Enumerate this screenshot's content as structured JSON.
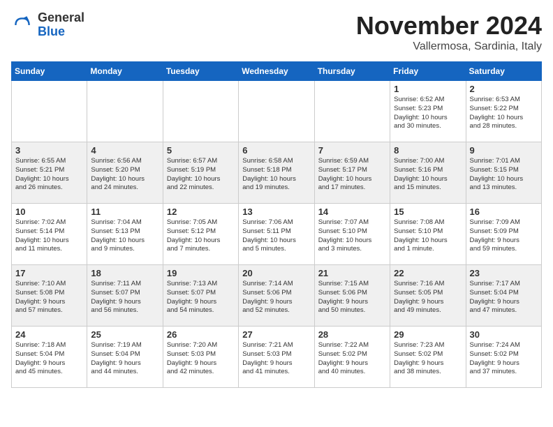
{
  "header": {
    "logo": {
      "text_general": "General",
      "text_blue": "Blue"
    },
    "title": "November 2024",
    "location": "Vallermosa, Sardinia, Italy"
  },
  "weekdays": [
    "Sunday",
    "Monday",
    "Tuesday",
    "Wednesday",
    "Thursday",
    "Friday",
    "Saturday"
  ],
  "weeks": [
    [
      {
        "day": "",
        "info": ""
      },
      {
        "day": "",
        "info": ""
      },
      {
        "day": "",
        "info": ""
      },
      {
        "day": "",
        "info": ""
      },
      {
        "day": "",
        "info": ""
      },
      {
        "day": "1",
        "info": "Sunrise: 6:52 AM\nSunset: 5:23 PM\nDaylight: 10 hours\nand 30 minutes."
      },
      {
        "day": "2",
        "info": "Sunrise: 6:53 AM\nSunset: 5:22 PM\nDaylight: 10 hours\nand 28 minutes."
      }
    ],
    [
      {
        "day": "3",
        "info": "Sunrise: 6:55 AM\nSunset: 5:21 PM\nDaylight: 10 hours\nand 26 minutes."
      },
      {
        "day": "4",
        "info": "Sunrise: 6:56 AM\nSunset: 5:20 PM\nDaylight: 10 hours\nand 24 minutes."
      },
      {
        "day": "5",
        "info": "Sunrise: 6:57 AM\nSunset: 5:19 PM\nDaylight: 10 hours\nand 22 minutes."
      },
      {
        "day": "6",
        "info": "Sunrise: 6:58 AM\nSunset: 5:18 PM\nDaylight: 10 hours\nand 19 minutes."
      },
      {
        "day": "7",
        "info": "Sunrise: 6:59 AM\nSunset: 5:17 PM\nDaylight: 10 hours\nand 17 minutes."
      },
      {
        "day": "8",
        "info": "Sunrise: 7:00 AM\nSunset: 5:16 PM\nDaylight: 10 hours\nand 15 minutes."
      },
      {
        "day": "9",
        "info": "Sunrise: 7:01 AM\nSunset: 5:15 PM\nDaylight: 10 hours\nand 13 minutes."
      }
    ],
    [
      {
        "day": "10",
        "info": "Sunrise: 7:02 AM\nSunset: 5:14 PM\nDaylight: 10 hours\nand 11 minutes."
      },
      {
        "day": "11",
        "info": "Sunrise: 7:04 AM\nSunset: 5:13 PM\nDaylight: 10 hours\nand 9 minutes."
      },
      {
        "day": "12",
        "info": "Sunrise: 7:05 AM\nSunset: 5:12 PM\nDaylight: 10 hours\nand 7 minutes."
      },
      {
        "day": "13",
        "info": "Sunrise: 7:06 AM\nSunset: 5:11 PM\nDaylight: 10 hours\nand 5 minutes."
      },
      {
        "day": "14",
        "info": "Sunrise: 7:07 AM\nSunset: 5:10 PM\nDaylight: 10 hours\nand 3 minutes."
      },
      {
        "day": "15",
        "info": "Sunrise: 7:08 AM\nSunset: 5:10 PM\nDaylight: 10 hours\nand 1 minute."
      },
      {
        "day": "16",
        "info": "Sunrise: 7:09 AM\nSunset: 5:09 PM\nDaylight: 9 hours\nand 59 minutes."
      }
    ],
    [
      {
        "day": "17",
        "info": "Sunrise: 7:10 AM\nSunset: 5:08 PM\nDaylight: 9 hours\nand 57 minutes."
      },
      {
        "day": "18",
        "info": "Sunrise: 7:11 AM\nSunset: 5:07 PM\nDaylight: 9 hours\nand 56 minutes."
      },
      {
        "day": "19",
        "info": "Sunrise: 7:13 AM\nSunset: 5:07 PM\nDaylight: 9 hours\nand 54 minutes."
      },
      {
        "day": "20",
        "info": "Sunrise: 7:14 AM\nSunset: 5:06 PM\nDaylight: 9 hours\nand 52 minutes."
      },
      {
        "day": "21",
        "info": "Sunrise: 7:15 AM\nSunset: 5:06 PM\nDaylight: 9 hours\nand 50 minutes."
      },
      {
        "day": "22",
        "info": "Sunrise: 7:16 AM\nSunset: 5:05 PM\nDaylight: 9 hours\nand 49 minutes."
      },
      {
        "day": "23",
        "info": "Sunrise: 7:17 AM\nSunset: 5:04 PM\nDaylight: 9 hours\nand 47 minutes."
      }
    ],
    [
      {
        "day": "24",
        "info": "Sunrise: 7:18 AM\nSunset: 5:04 PM\nDaylight: 9 hours\nand 45 minutes."
      },
      {
        "day": "25",
        "info": "Sunrise: 7:19 AM\nSunset: 5:04 PM\nDaylight: 9 hours\nand 44 minutes."
      },
      {
        "day": "26",
        "info": "Sunrise: 7:20 AM\nSunset: 5:03 PM\nDaylight: 9 hours\nand 42 minutes."
      },
      {
        "day": "27",
        "info": "Sunrise: 7:21 AM\nSunset: 5:03 PM\nDaylight: 9 hours\nand 41 minutes."
      },
      {
        "day": "28",
        "info": "Sunrise: 7:22 AM\nSunset: 5:02 PM\nDaylight: 9 hours\nand 40 minutes."
      },
      {
        "day": "29",
        "info": "Sunrise: 7:23 AM\nSunset: 5:02 PM\nDaylight: 9 hours\nand 38 minutes."
      },
      {
        "day": "30",
        "info": "Sunrise: 7:24 AM\nSunset: 5:02 PM\nDaylight: 9 hours\nand 37 minutes."
      }
    ]
  ]
}
